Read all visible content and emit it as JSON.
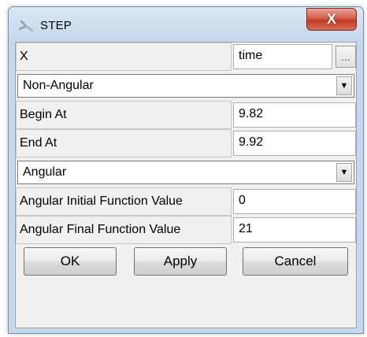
{
  "window": {
    "title": "STEP",
    "close_glyph": "X"
  },
  "x_row": {
    "label": "X",
    "value": "time",
    "browse_label": "..."
  },
  "combo1": {
    "selected": "Non-Angular"
  },
  "begin": {
    "label": "Begin At",
    "value": "9.82"
  },
  "end": {
    "label": "End At",
    "value": "9.92"
  },
  "combo2": {
    "selected": "Angular"
  },
  "angular_initial": {
    "label": "Angular Initial Function Value",
    "value": "0"
  },
  "angular_final": {
    "label": "Angular Final Function Value",
    "value": "21"
  },
  "buttons": {
    "ok": "OK",
    "apply": "Apply",
    "cancel": "Cancel"
  },
  "icons": {
    "window": "step-function-icon",
    "dropdown": "chevron-down-icon"
  }
}
